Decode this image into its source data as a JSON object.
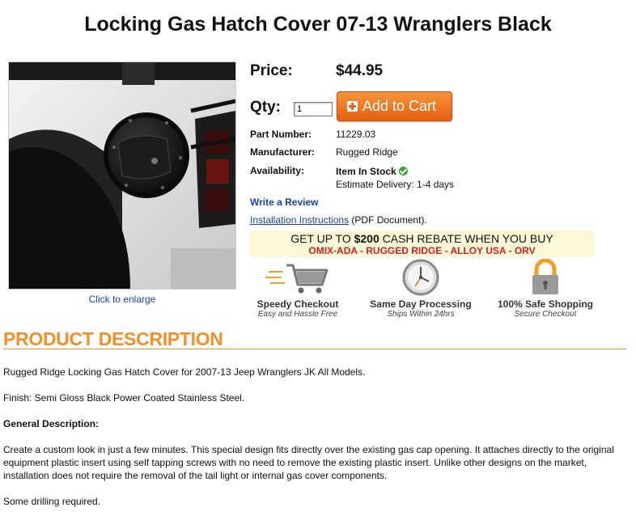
{
  "product": {
    "title": "Locking Gas Hatch Cover 07-13 Wranglers Black",
    "click_to_enlarge": "Click to enlarge"
  },
  "purchase": {
    "price_label": "Price:",
    "price_value": "$44.95",
    "qty_label": "Qty:",
    "qty_value": "1",
    "add_to_cart_label": "Add to Cart"
  },
  "specs": {
    "part_number_label": "Part Number:",
    "part_number_value": "11229.03",
    "manufacturer_label": "Manufacturer:",
    "manufacturer_value": "Rugged Ridge",
    "availability_label": "Availability:",
    "availability_value": "Item In Stock",
    "delivery_value": "Estimate Delivery: 1-4 days"
  },
  "links": {
    "write_review": "Write a Review",
    "installation": "Installation Instructions",
    "installation_suffix": " (PDF Document)."
  },
  "rebate": {
    "prefix": "GET UP TO ",
    "amount": "$200",
    "suffix": " CASH REBATE WHEN YOU BUY",
    "brands": "OMIX-ADA - RUGGED RIDGE - ALLOY USA - ORV"
  },
  "badges": [
    {
      "title": "Speedy Checkout",
      "subtitle": "Easy and Hassle Free",
      "icon": "shopping-cart-icon"
    },
    {
      "title": "Same Day Processing",
      "subtitle": "Ships Within 24hrs",
      "icon": "clock-icon"
    },
    {
      "title": "100% Safe Shopping",
      "subtitle": "Secure Checkout",
      "icon": "padlock-icon"
    }
  ],
  "description": {
    "heading": "PRODUCT DESCRIPTION",
    "p1": "Rugged Ridge Locking Gas Hatch Cover for 2007-13 Jeep Wranglers JK All Models.",
    "p2": "Finish: Semi Gloss Black Power Coated Stainless Steel.",
    "p3_heading": "General Description:",
    "p4": "Create a custom look in just a few minutes. This special design fits directly over the existing gas cap opening. It attaches directly to the original equipment plastic insert using self tapping screws with no need to remove the existing plastic insert. Unlike other designs on the market, installation does not require the removal of the tail light or internal gas cover components.",
    "p5": "Some drilling required."
  },
  "colors": {
    "accent_orange": "#f0902a",
    "link_blue": "#1a3fb0",
    "cart_button": "#e8651a",
    "rebate_red": "#d4202a",
    "stock_green": "#3aaa35"
  }
}
